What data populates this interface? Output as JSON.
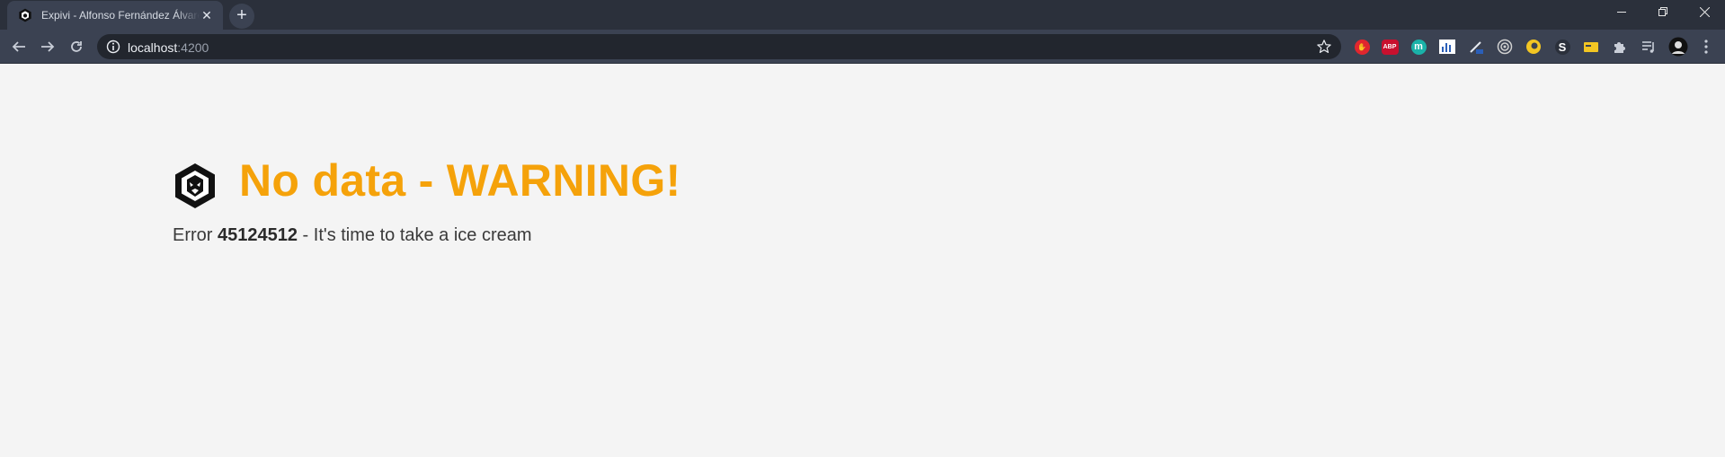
{
  "browser": {
    "tab_title": "Expivi - Alfonso Fernández Álvarez",
    "url_host": "localhost",
    "url_port": ":4200",
    "new_tab_icon": "plus-icon",
    "extensions": [
      {
        "name": "adblock-hand",
        "color": "#e0262e",
        "text": ""
      },
      {
        "name": "abp",
        "color": "#c8102e",
        "text": "ABP"
      },
      {
        "name": "m-extension",
        "color": "#1ab2a8",
        "text": "m"
      },
      {
        "name": "bar-chart-ext",
        "color": "#ffffff",
        "text": ""
      },
      {
        "name": "pen-ext",
        "color": "#5b8def",
        "text": ""
      },
      {
        "name": "target-ext",
        "color": "#d0d0d0",
        "text": ""
      },
      {
        "name": "yellow-circle-ext",
        "color": "#f3c623",
        "text": ""
      },
      {
        "name": "s-ext",
        "color": "#2b303b",
        "text": "S"
      },
      {
        "name": "yellow-folder-ext",
        "color": "#f3c623",
        "text": ""
      },
      {
        "name": "puzzle-ext",
        "color": "#c9ced8",
        "text": ""
      },
      {
        "name": "media-ext",
        "color": "#c9ced8",
        "text": ""
      },
      {
        "name": "avatar",
        "color": "#111111",
        "text": ""
      }
    ]
  },
  "content": {
    "heading": "No data - WARNING!",
    "error_prefix": "Error ",
    "error_code": "45124512",
    "error_suffix": " - It's time to take a ice cream",
    "accent_color": "#f5a20a"
  }
}
